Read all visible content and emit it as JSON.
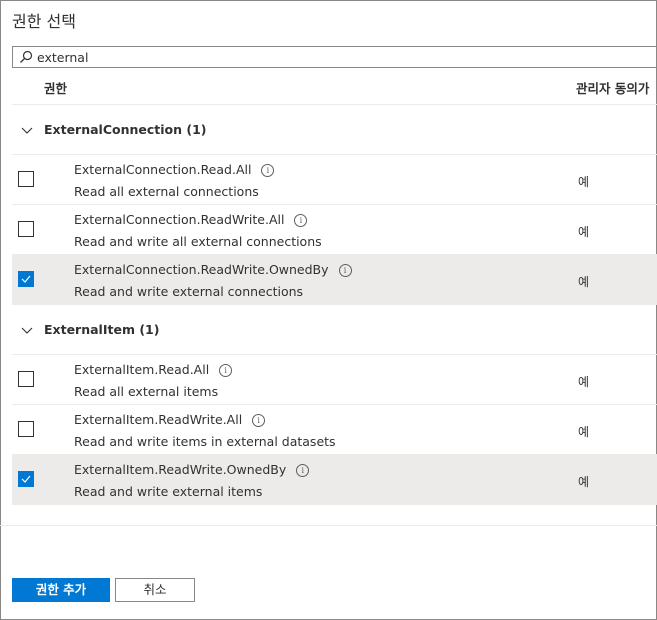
{
  "dialog": {
    "title": "권한 선택"
  },
  "search": {
    "value": "external",
    "icon": "search-icon"
  },
  "table": {
    "columns": {
      "permission": "권한",
      "admin_consent": "관리자 동의가"
    }
  },
  "groups": [
    {
      "title": "ExternalConnection (1)",
      "expanded": true,
      "rows": [
        {
          "name": "ExternalConnection.Read.All",
          "description": "Read all external connections",
          "consent": "예",
          "checked": false
        },
        {
          "name": "ExternalConnection.ReadWrite.All",
          "description": "Read and write all external connections",
          "consent": "예",
          "checked": false
        },
        {
          "name": "ExternalConnection.ReadWrite.OwnedBy",
          "description": "Read and write external connections",
          "consent": "예",
          "checked": true
        }
      ]
    },
    {
      "title": "ExternalItem (1)",
      "expanded": true,
      "rows": [
        {
          "name": "ExternalItem.Read.All",
          "description": "Read all external items",
          "consent": "예",
          "checked": false
        },
        {
          "name": "ExternalItem.ReadWrite.All",
          "description": "Read and write items in external datasets",
          "consent": "예",
          "checked": false
        },
        {
          "name": "ExternalItem.ReadWrite.OwnedBy",
          "description": "Read and write external items",
          "consent": "예",
          "checked": true
        }
      ]
    }
  ],
  "footer": {
    "add_label": "권한 추가",
    "cancel_label": "취소"
  },
  "colors": {
    "accent": "#0078d4",
    "selected_row": "#edebe9"
  }
}
